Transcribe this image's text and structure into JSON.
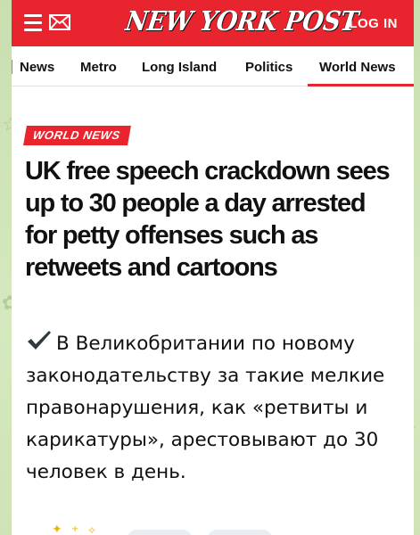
{
  "header": {
    "logo_text": "NEW YORK POST",
    "login_label": "LOG IN",
    "brand_color": "#e8252e"
  },
  "nav": {
    "items": [
      {
        "label": "News"
      },
      {
        "label": "Metro"
      },
      {
        "label": "Long Island"
      },
      {
        "label": "Politics"
      },
      {
        "label": "World News",
        "active": true
      }
    ]
  },
  "article": {
    "section_label": "WORLD NEWS",
    "headline": "UK free speech crackdown sees up to 30 people a day arrested for petty offenses such as retweets and cartoons"
  },
  "message": {
    "icon": "check-mark-icon",
    "text": "В Великобритании по новому законодательству за такие мелкие правонарушения, как «ретвиты и карикатуры», арестовывают до 30 человек в день."
  }
}
